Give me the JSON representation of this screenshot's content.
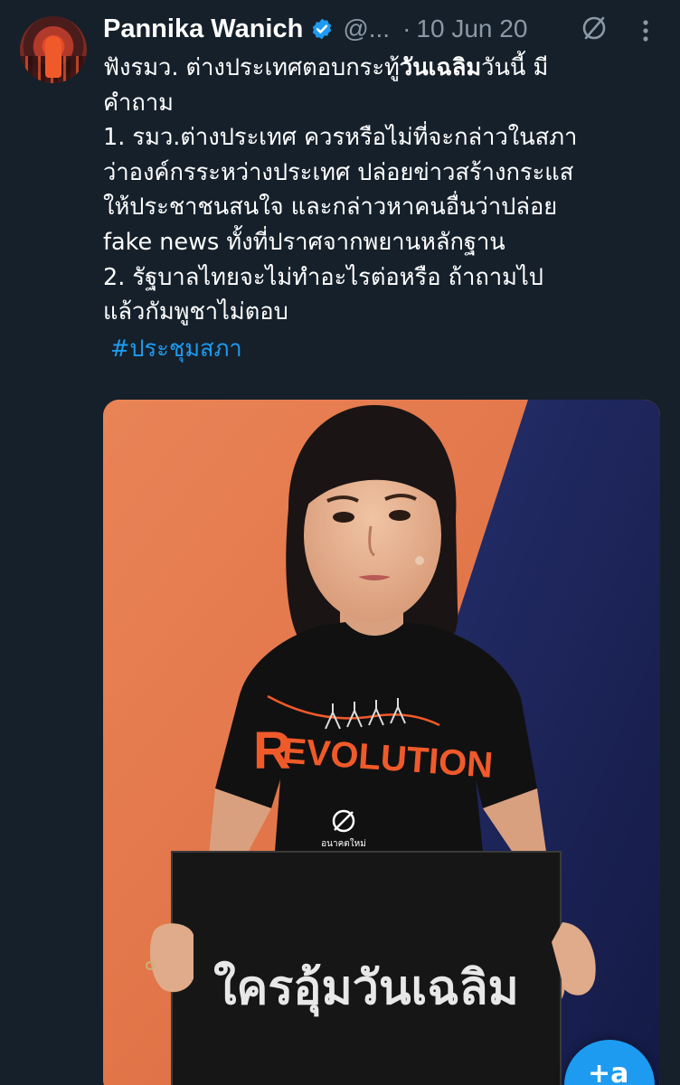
{
  "author": {
    "name": "Pannika Wanich",
    "handle": "@...",
    "separator": "·",
    "date": "10 Jun 20"
  },
  "tweet": {
    "line1_prefix": "ฟังรมว. ต่างประเทศตอบกระทู้",
    "line1_bold": "วันเฉลิม",
    "line1_suffix": "วันนี้ มี",
    "line2": "คำถาม",
    "line3": "1. รมว.ต่างประเทศ ควรหรือไม่ที่จะกล่าวในสภา",
    "line4": "ว่าองค์กรระหว่างประเทศ ปล่อยข่าวสร้างกระแส",
    "line5": "ให้ประชาชนสนใจ และกล่าวหาคนอื่นว่าปล่อย",
    "line6": "fake news ทั้งที่ปราศจากพยานหลักฐาน",
    "line7": "2. รัฐบาลไทยจะไม่ทำอะไรต่อหรือ ถ้าถามไป",
    "line8": "แล้วกัมพูชาไม่ตอบ",
    "hashtag": "#ประชุมสภา"
  },
  "image": {
    "shirt_text": "EVOLUTION",
    "shirt_initial": "R",
    "shirt_logo_caption": "อนาคตใหม่",
    "sign_text": "ใครอุ้มวันเฉลิม"
  },
  "compose_button": {
    "label": "+a"
  },
  "colors": {
    "background": "#15202b",
    "accent": "#1d9bf0",
    "secondary_text": "#8b98a5",
    "wall_orange": "#e77f52",
    "wall_navy": "#1e2457"
  },
  "icons": [
    "verified-badge-icon",
    "hide-reply-icon",
    "more-options-icon"
  ]
}
